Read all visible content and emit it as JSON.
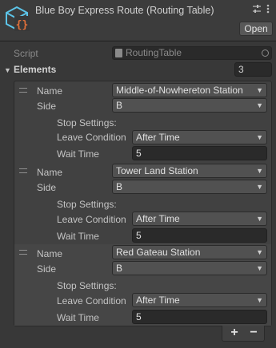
{
  "header": {
    "title": "Blue Boy Express Route (Routing Table)",
    "open_label": "Open",
    "icons": [
      "script-asset-icon",
      "sliders-icon",
      "more-options-icon"
    ]
  },
  "script": {
    "label": "Script",
    "value": "RoutingTable"
  },
  "elements": {
    "label": "Elements",
    "count": "3",
    "items": [
      {
        "name_label": "Name",
        "name_value": "Middle-of-Nowhereton Station",
        "side_label": "Side",
        "side_value": "B",
        "stop_settings_label": "Stop Settings:",
        "leave_condition_label": "Leave Condition",
        "leave_condition_value": "After Time",
        "wait_time_label": "Wait Time",
        "wait_time_value": "5"
      },
      {
        "name_label": "Name",
        "name_value": "Tower Land Station",
        "side_label": "Side",
        "side_value": "B",
        "stop_settings_label": "Stop Settings:",
        "leave_condition_label": "Leave Condition",
        "leave_condition_value": "After Time",
        "wait_time_label": "Wait Time",
        "wait_time_value": "5"
      },
      {
        "name_label": "Name",
        "name_value": "Red Gateau Station",
        "side_label": "Side",
        "side_value": "B",
        "stop_settings_label": "Stop Settings:",
        "leave_condition_label": "Leave Condition",
        "leave_condition_value": "After Time",
        "wait_time_label": "Wait Time",
        "wait_time_value": "5"
      }
    ]
  },
  "footer": {
    "add_label": "+",
    "remove_label": "−"
  },
  "colors": {
    "accent": "#5cc4e8",
    "accent_dark": "#e2703a"
  }
}
